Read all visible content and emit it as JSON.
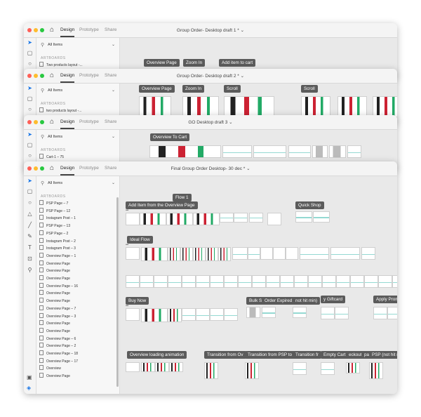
{
  "tabs": [
    "Design",
    "Prototype",
    "Share"
  ],
  "windows": [
    {
      "title": "Group Order- Desktop draft 1 *",
      "search": "All Items",
      "section": "ARTBOARDS",
      "first_item": "Two products layout -...",
      "labels": [
        "Overview Page",
        "Zoom In",
        "Add item to cart"
      ]
    },
    {
      "title": "Group Order- Desktop draft 2 *",
      "search": "All Items",
      "section": "ARTBOARDS",
      "first_item": "two products layout -...",
      "labels": [
        "Overview Page",
        "Zoom In",
        "Scroll",
        "Scroll"
      ]
    },
    {
      "title": "GO Desktop draft 3",
      "search": "All Items",
      "section": "ARTBOARDS",
      "first_item": "Cart-1 – 75",
      "labels": [
        "Overview To Cart"
      ]
    },
    {
      "title": "Final Group Order Desktop- 30 dec *",
      "search": "All Items",
      "section": "ARTBOARDS",
      "items": [
        "PSP Page – 7",
        "PSP Page – 12",
        "Instagram Post – 1",
        "PSP Page – 13",
        "PSP Page – 2",
        "Instagram Post – 2",
        "Instagram Post – 3",
        "Overview Page – 1",
        "Overview Page",
        "Overview Page",
        "Overview Page",
        "Overview Page – 16",
        "Overview Page",
        "Overview Page",
        "Overview Page – 7",
        "Overview Page – 3",
        "Overview Page",
        "Overview Page",
        "Overview Page – 6",
        "Overview Page – 2",
        "Overview Page – 18",
        "Overview Page – 17",
        "Overview",
        "Overview Page"
      ],
      "labels": {
        "flow1": "Flow 1",
        "add_item": "Add Item from the Overview Page",
        "quick_shop": "Quick Shop",
        "ideal_flow": "Ideal Flow",
        "buy_now": "Buy Now",
        "bulk": "Bulk Sl",
        "order_expired": "Order Expired",
        "not_hit": "not hit min)",
        "giftcard": "y Giftcard",
        "apply_promo": "Apply Promocode",
        "overview_loading": "Overview loading animation",
        "trans_ov": "Transition from Ov",
        "trans_psp": "Transition from PSP to",
        "trans_fr": "Transition fr",
        "empty_cart": "Empty Cart",
        "checkout": "eckout",
        "par": "par",
        "psp_not_hit": "PSP (not hit min)"
      }
    }
  ],
  "icons": {
    "home": "home-icon",
    "search": "search-icon",
    "chevron": "chevron-down-icon"
  }
}
